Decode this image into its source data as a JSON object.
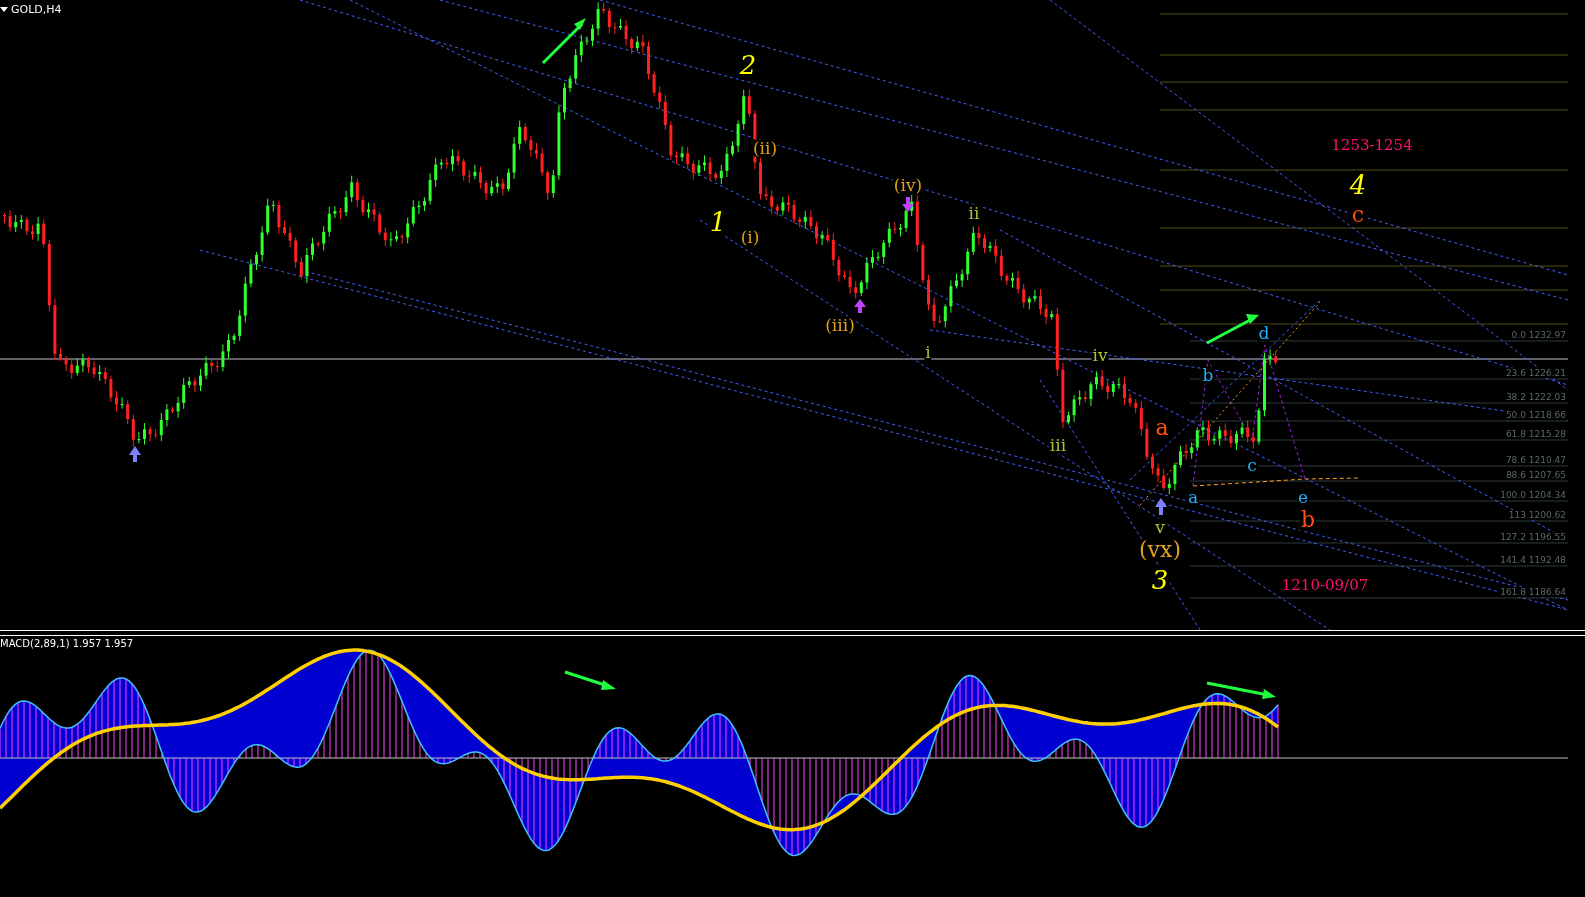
{
  "chart": {
    "title": "GOLD,H4",
    "wave_labels": [
      {
        "text": "2",
        "kind": "major",
        "color": "#ffff00"
      },
      {
        "text": "1",
        "kind": "major",
        "color": "#ffff00"
      },
      {
        "text": "(ii)",
        "kind": "minor",
        "color": "#e0a020"
      },
      {
        "text": "(i)",
        "kind": "minor",
        "color": "#e0a020"
      },
      {
        "text": "(iv)",
        "kind": "minor",
        "color": "#e0a020"
      },
      {
        "text": "(iii)",
        "kind": "minor",
        "color": "#e0a020"
      },
      {
        "text": "ii",
        "kind": "minor",
        "color": "#b0c030"
      },
      {
        "text": "i",
        "kind": "minor",
        "color": "#b0c030"
      },
      {
        "text": "iv",
        "kind": "minor",
        "color": "#b0c030"
      },
      {
        "text": "iii",
        "kind": "minor",
        "color": "#b0c030"
      },
      {
        "text": "a",
        "kind": "medium",
        "color": "#ff5010"
      },
      {
        "text": "v",
        "kind": "minor",
        "color": "#b0c030"
      },
      {
        "text": "(vx)",
        "kind": "medium",
        "color": "#e0a020"
      },
      {
        "text": "3",
        "kind": "major",
        "color": "#ffff00"
      },
      {
        "text": "a",
        "kind": "minor",
        "color": "#20b0ff"
      },
      {
        "text": "b",
        "kind": "minor",
        "color": "#20b0ff"
      },
      {
        "text": "c",
        "kind": "minor",
        "color": "#20b0ff"
      },
      {
        "text": "d",
        "kind": "minor",
        "color": "#20b0ff"
      },
      {
        "text": "e",
        "kind": "minor",
        "color": "#20b0ff"
      },
      {
        "text": "b",
        "kind": "medium",
        "color": "#ff5010"
      },
      {
        "text": "1253-1254",
        "kind": "note",
        "color": "#ff1070"
      },
      {
        "text": "4",
        "kind": "major",
        "color": "#ffff00"
      },
      {
        "text": "c",
        "kind": "medium",
        "color": "#ff5010"
      },
      {
        "text": "1210-09/07",
        "kind": "note",
        "color": "#ff1070"
      }
    ],
    "fib_levels": [
      "0.0 1232.97",
      "23.6 1226.21",
      "38.2 1222.03",
      "50.0 1218.66",
      "61.8 1215.28",
      "78.6 1210.47",
      "88.6 1207.65",
      "100.0 1204.34",
      "113 1200.62",
      "127.2 1196.55",
      "141.4 1192.48",
      "161.8 1186.64"
    ]
  },
  "indicator": {
    "label": "MACD(2,89,1) 1.957 1.957"
  }
}
